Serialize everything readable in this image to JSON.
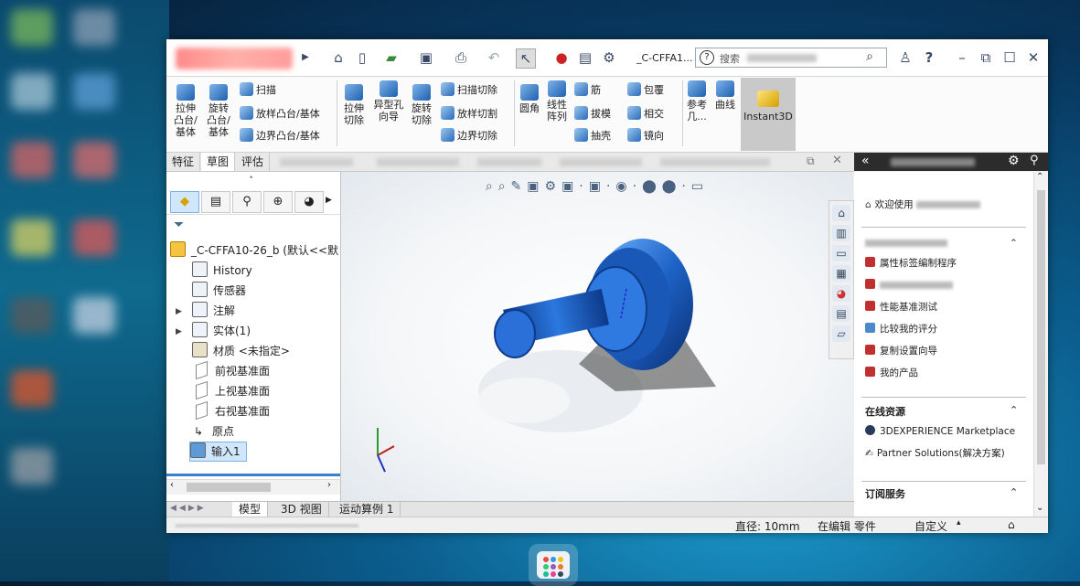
{
  "window": {
    "doc_title": "_C-CFFA1...",
    "search_placeholder": "搜索"
  },
  "ribbon": {
    "extrude_boss": "拉伸\n凸台/\n基体",
    "revolve_boss": "旋转\n凸台/\n基体",
    "sweep": "扫描",
    "loft_boss": "放样凸台/基体",
    "boundary_boss": "边界凸台/基体",
    "extrude_cut": "拉伸\n切除",
    "hole_wizard": "异型孔\n向导",
    "revolve_cut": "旋转\n切除",
    "swept_cut": "扫描切除",
    "lofted_cut": "放样切割",
    "boundary_cut": "边界切除",
    "fillet": "圆角",
    "linear_pattern": "线性\n阵列",
    "rib": "筋",
    "draft": "拔模",
    "shell": "抽壳",
    "wrap": "包覆",
    "intersect": "相交",
    "mirror": "镜向",
    "ref_geometry": "参考\n几...",
    "curves": "曲线",
    "instant3d": "Instant3D"
  },
  "cm_tabs": [
    "特征",
    "草图",
    "评估"
  ],
  "tree": {
    "root": "_C-CFFA10-26_b (默认<<默",
    "items": [
      "History",
      "传感器",
      "注解",
      "实体(1)",
      "材质 <未指定>",
      "前视基准面",
      "上视基准面",
      "右视基准面",
      "原点",
      "输入1"
    ]
  },
  "bottom_tabs": [
    "模型",
    "3D 视图",
    "运动算例 1"
  ],
  "status": {
    "diameter": "直径: 10mm",
    "editing": "在编辑 零件",
    "custom": "自定义"
  },
  "task_pane": {
    "welcome": "欢迎使用",
    "tools": [
      "属性标签编制程序",
      "性能基准测试",
      "比较我的评分",
      "复制设置向导",
      "我的产品"
    ],
    "online_title": "在线资源",
    "online": [
      "3DEXPERIENCE Marketplace",
      "Partner Solutions(解决方案)"
    ],
    "subscription_title": "订阅服务"
  },
  "colors": {
    "part_blue": "#1e63c8",
    "ribbon_active": "#c9c9c9",
    "selection": "#cfe6fb"
  }
}
